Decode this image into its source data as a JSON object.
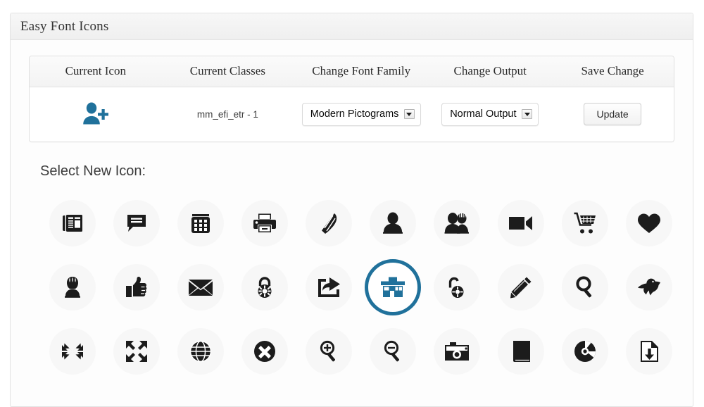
{
  "panel": {
    "title": "Easy Font Icons"
  },
  "table": {
    "headers": [
      "Current Icon",
      "Current Classes",
      "Change Font Family",
      "Change Output",
      "Save Change"
    ],
    "row": {
      "current_icon_name": "add-user-icon",
      "current_icon_color": "#20719b",
      "current_classes": "mm_efi_etr - 1",
      "font_family_selected": "Modern Pictograms",
      "font_family_options": [
        "Modern Pictograms"
      ],
      "output_selected": "Normal Output",
      "output_options": [
        "Normal Output"
      ],
      "save_button_label": "Update"
    }
  },
  "picker": {
    "label": "Select New Icon:",
    "selected_index": 15,
    "selected_color": "#20719b",
    "icon_color": "#1c1c1c",
    "icons": [
      {
        "name": "newspaper-icon",
        "glyph": "newspaper"
      },
      {
        "name": "chat-bubble-icon",
        "glyph": "chat"
      },
      {
        "name": "telephone-icon",
        "glyph": "phone"
      },
      {
        "name": "printer-icon",
        "glyph": "printer"
      },
      {
        "name": "quill-pen-icon",
        "glyph": "quill"
      },
      {
        "name": "user-icon",
        "glyph": "user"
      },
      {
        "name": "users-group-icon",
        "glyph": "users"
      },
      {
        "name": "video-camera-icon",
        "glyph": "video"
      },
      {
        "name": "shopping-cart-icon",
        "glyph": "cart"
      },
      {
        "name": "heart-icon",
        "glyph": "heart"
      },
      {
        "name": "user-female-icon",
        "glyph": "user-female"
      },
      {
        "name": "thumbs-up-icon",
        "glyph": "thumbs-up"
      },
      {
        "name": "envelope-icon",
        "glyph": "envelope"
      },
      {
        "name": "lock-closed-icon",
        "glyph": "lock"
      },
      {
        "name": "share-export-icon",
        "glyph": "share"
      },
      {
        "name": "store-shop-icon",
        "glyph": "store"
      },
      {
        "name": "lock-open-icon",
        "glyph": "unlock"
      },
      {
        "name": "pencil-icon",
        "glyph": "pencil"
      },
      {
        "name": "magnifier-icon",
        "glyph": "search"
      },
      {
        "name": "bird-icon",
        "glyph": "bird"
      },
      {
        "name": "collapse-arrows-icon",
        "glyph": "collapse"
      },
      {
        "name": "expand-arrows-icon",
        "glyph": "expand"
      },
      {
        "name": "globe-icon",
        "glyph": "globe"
      },
      {
        "name": "close-circle-icon",
        "glyph": "close-circle"
      },
      {
        "name": "zoom-in-icon",
        "glyph": "zoom-in"
      },
      {
        "name": "zoom-out-icon",
        "glyph": "zoom-out"
      },
      {
        "name": "camera-icon",
        "glyph": "camera"
      },
      {
        "name": "book-icon",
        "glyph": "book"
      },
      {
        "name": "disc-icon",
        "glyph": "disc"
      },
      {
        "name": "file-download-icon",
        "glyph": "file-download"
      }
    ]
  }
}
